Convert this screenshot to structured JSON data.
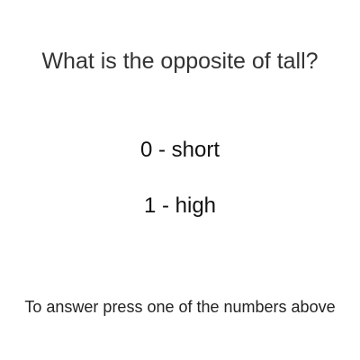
{
  "question": {
    "text": "What is the opposite of tall?"
  },
  "options": [
    {
      "label": "0 - short"
    },
    {
      "label": "1 - high"
    }
  ],
  "instruction": {
    "text": "To answer press one of the numbers above"
  }
}
